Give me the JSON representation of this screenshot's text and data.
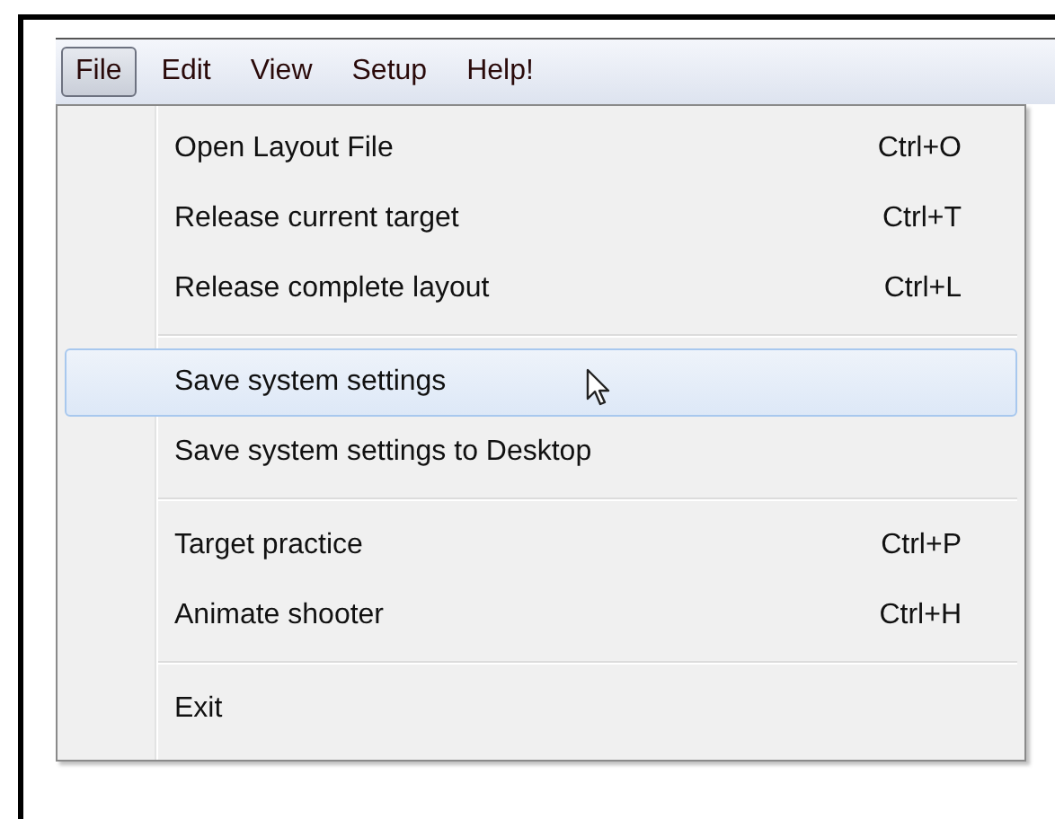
{
  "menu_bar": [
    {
      "label": "File",
      "selected": true
    },
    {
      "label": "Edit",
      "selected": false
    },
    {
      "label": "View",
      "selected": false
    },
    {
      "label": "Setup",
      "selected": false
    },
    {
      "label": "Help!",
      "selected": false
    }
  ],
  "dropdown": [
    {
      "kind": "item",
      "label": "Open Layout File",
      "shortcut": "Ctrl+O",
      "selected": false
    },
    {
      "kind": "item",
      "label": "Release current target",
      "shortcut": "Ctrl+T",
      "selected": false
    },
    {
      "kind": "item",
      "label": "Release complete layout",
      "shortcut": "Ctrl+L",
      "selected": false
    },
    {
      "kind": "separator"
    },
    {
      "kind": "item",
      "label": "Save system settings",
      "selected": true
    },
    {
      "kind": "item",
      "label": "Save system settings to Desktop",
      "selected": false
    },
    {
      "kind": "separator"
    },
    {
      "kind": "item",
      "label": "Target practice",
      "shortcut": "Ctrl+P",
      "selected": false
    },
    {
      "kind": "item",
      "label": "Animate shooter",
      "shortcut": "Ctrl+H",
      "selected": false
    },
    {
      "kind": "separator"
    },
    {
      "kind": "item",
      "label": "Exit",
      "selected": false
    }
  ]
}
